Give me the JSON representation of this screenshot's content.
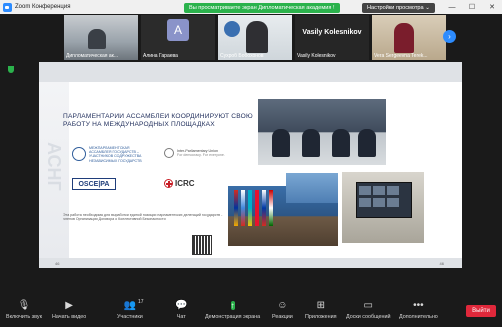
{
  "window": {
    "title": "Zoom Конференция"
  },
  "banner": {
    "text": "Вы просматриваете экран Дипломатическая академия !",
    "view_options": "Настройки просмотра ⌄"
  },
  "participants": [
    {
      "name": "Дипломатическая ак..."
    },
    {
      "initial": "A",
      "name": "Алина Гараева"
    },
    {
      "name": "Сухроб Бобохонов"
    },
    {
      "display": "Vasily Kolesnikov",
      "name": "Vasily Kolesnikov"
    },
    {
      "name": "Vera Sergeevna Terek..."
    }
  ],
  "slide": {
    "title": "ПАРЛАМЕНТАРИИ АССАМБЛЕИ КООРДИНИРУЮТ СВОЮ РАБОТУ НА МЕЖДУНАРОДНЫХ ПЛОЩАДКАХ",
    "org1": "МЕЖПАРЛАМЕНТСКАЯ АССАМБЛЕЯ ГОСУДАРСТВ – УЧАСТНИКОВ СОДРУЖЕСТВА НЕЗАВИСИМЫХ ГОСУДАРСТВ",
    "org2": "Inter-Parliamentary Union",
    "org2_sub": "For democracy. For everyone.",
    "osce": "OSCE|PA",
    "icrc": "ICRC",
    "caption": "Эта работа необходима для выработки единой позиции парламентских делегаций государств - членов Организации Договора о Коллективной Безопасности",
    "footer_left": "46",
    "footer_right": "46",
    "watermark": "АСНГ"
  },
  "toolbar": {
    "mute": "Включить звук",
    "video": "Начать видео",
    "participants": "Участники",
    "participants_count": "17",
    "chat": "Чат",
    "share": "Демонстрация экрана",
    "reactions": "Реакции",
    "apps": "Приложения",
    "whiteboards": "Доски сообщений",
    "more": "Дополнительно",
    "leave": "Выйти"
  },
  "colors": {
    "zoom_blue": "#2d8cff",
    "share_green": "#2bb24c",
    "leave_red": "#e0283b"
  }
}
